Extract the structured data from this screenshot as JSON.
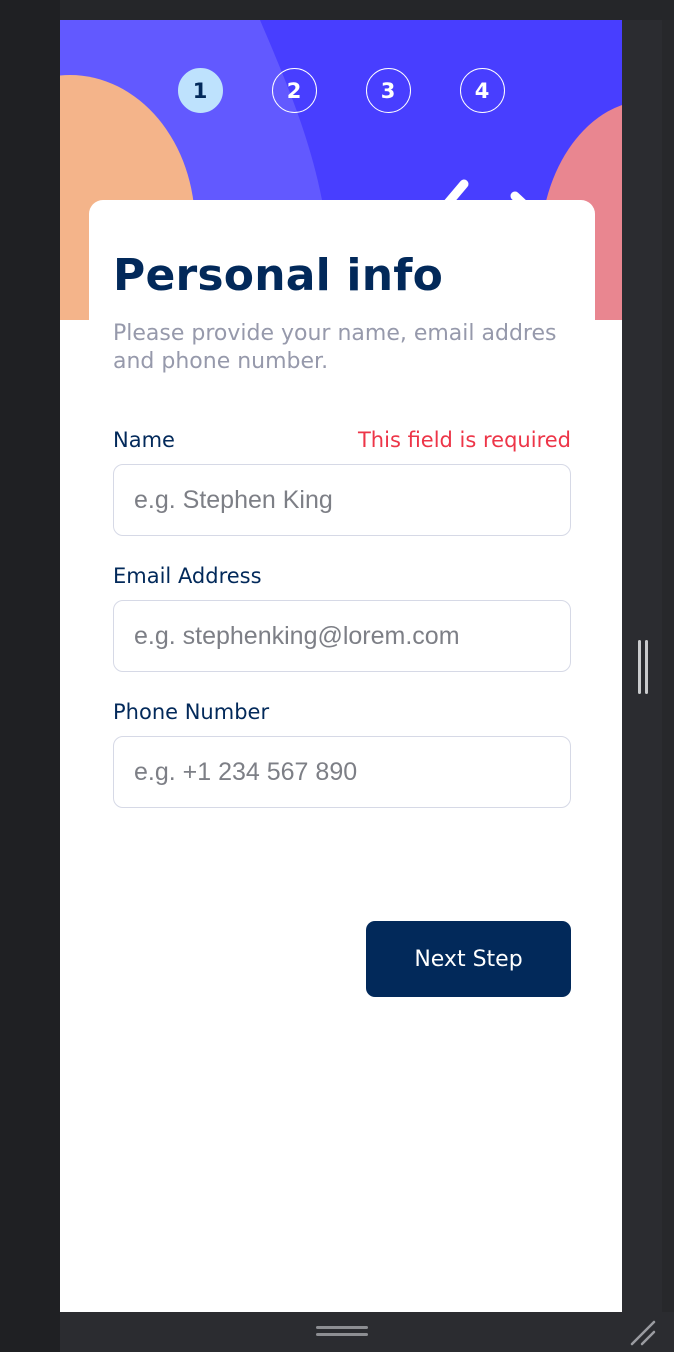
{
  "steps": [
    {
      "number": "1",
      "active": true
    },
    {
      "number": "2",
      "active": false
    },
    {
      "number": "3",
      "active": false
    },
    {
      "number": "4",
      "active": false
    }
  ],
  "form": {
    "title": "Personal info",
    "subtitle": "Please provide your name, email addres and phone number.",
    "fields": [
      {
        "label": "Name",
        "placeholder": "e.g. Stephen King",
        "value": "",
        "error": "This field is required"
      },
      {
        "label": "Email Address",
        "placeholder": "e.g. stephenking@lorem.com",
        "value": "",
        "error": ""
      },
      {
        "label": "Phone Number",
        "placeholder": "e.g. +1 234 567 890",
        "value": "",
        "error": ""
      }
    ],
    "next_label": "Next Step"
  },
  "colors": {
    "marine_blue": "#02295a",
    "purple_blue": "#473dff",
    "light_blue": "#bee2fd",
    "strawberry_red": "#ed3548",
    "cool_gray": "#9699ab",
    "light_gray": "#d6d9e6",
    "orange_blob": "#f4b48a",
    "pink_blob": "#e98690"
  },
  "icons": [
    "grip-icon",
    "resize-handle-icon"
  ]
}
